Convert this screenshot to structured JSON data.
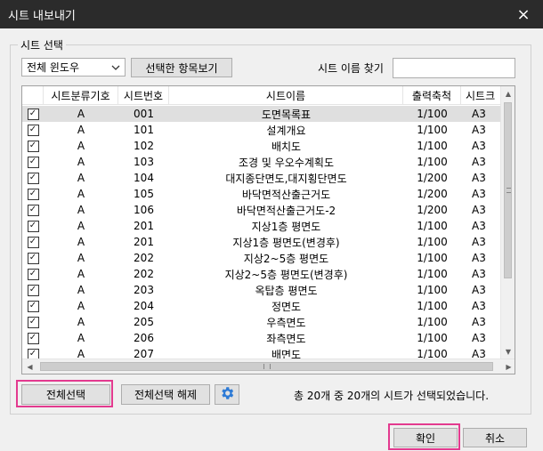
{
  "window": {
    "title": "시트 내보내기",
    "close_icon": "×"
  },
  "sheet_select": {
    "group_label": "시트 선택",
    "filter_value": "전체 윈도우",
    "show_selected_label": "선택한 항목보기",
    "search_label": "시트 이름 찾기",
    "search_value": ""
  },
  "table": {
    "columns": [
      "",
      "시트분류기호",
      "시트번호",
      "시트이름",
      "출력축척",
      "시트크"
    ],
    "rows": [
      {
        "checked": true,
        "class": "A",
        "number": "001",
        "name": "도면목록표",
        "scale": "1/100",
        "size": "A3",
        "selected": true
      },
      {
        "checked": true,
        "class": "A",
        "number": "101",
        "name": "설계개요",
        "scale": "1/100",
        "size": "A3"
      },
      {
        "checked": true,
        "class": "A",
        "number": "102",
        "name": "배치도",
        "scale": "1/100",
        "size": "A3"
      },
      {
        "checked": true,
        "class": "A",
        "number": "103",
        "name": "조경 및 우오수계획도",
        "scale": "1/100",
        "size": "A3"
      },
      {
        "checked": true,
        "class": "A",
        "number": "104",
        "name": "대지종단면도,대지횡단면도",
        "scale": "1/200",
        "size": "A3"
      },
      {
        "checked": true,
        "class": "A",
        "number": "105",
        "name": "바닥면적산출근거도",
        "scale": "1/200",
        "size": "A3"
      },
      {
        "checked": true,
        "class": "A",
        "number": "106",
        "name": "바닥면적산출근거도-2",
        "scale": "1/200",
        "size": "A3"
      },
      {
        "checked": true,
        "class": "A",
        "number": "201",
        "name": "지상1층 평면도",
        "scale": "1/100",
        "size": "A3"
      },
      {
        "checked": true,
        "class": "A",
        "number": "201",
        "name": "지상1층 평면도(변경후)",
        "scale": "1/100",
        "size": "A3"
      },
      {
        "checked": true,
        "class": "A",
        "number": "202",
        "name": "지상2~5층 평면도",
        "scale": "1/100",
        "size": "A3"
      },
      {
        "checked": true,
        "class": "A",
        "number": "202",
        "name": "지상2~5층 평면도(변경후)",
        "scale": "1/100",
        "size": "A3"
      },
      {
        "checked": true,
        "class": "A",
        "number": "203",
        "name": "옥탑층 평면도",
        "scale": "1/100",
        "size": "A3"
      },
      {
        "checked": true,
        "class": "A",
        "number": "204",
        "name": "정면도",
        "scale": "1/100",
        "size": "A3"
      },
      {
        "checked": true,
        "class": "A",
        "number": "205",
        "name": "우측면도",
        "scale": "1/100",
        "size": "A3"
      },
      {
        "checked": true,
        "class": "A",
        "number": "206",
        "name": "좌측면도",
        "scale": "1/100",
        "size": "A3"
      },
      {
        "checked": true,
        "class": "A",
        "number": "207",
        "name": "배면도",
        "scale": "1/100",
        "size": "A3"
      }
    ]
  },
  "actions": {
    "select_all_label": "전체선택",
    "deselect_all_label": "전체선택 해제",
    "settings_icon": "gear-icon",
    "status_text": "총 20개 중 20개의 시트가 선택되었습니다."
  },
  "footer": {
    "ok_label": "확인",
    "cancel_label": "취소"
  },
  "colors": {
    "highlight": "#e33a8f",
    "titlebar": "#2b2b2b",
    "gear": "#2e7bd6"
  }
}
